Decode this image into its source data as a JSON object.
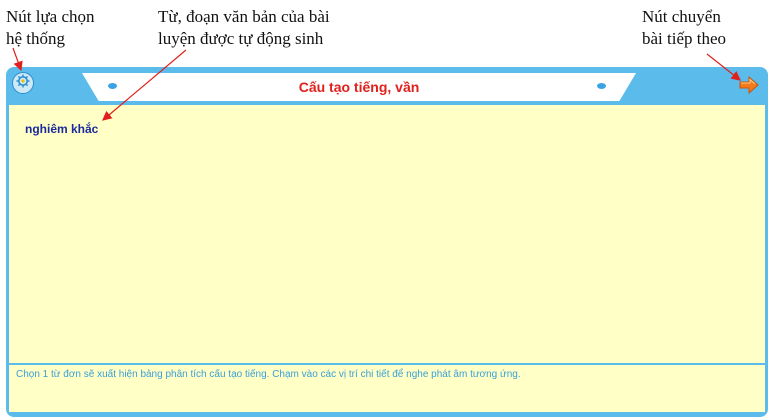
{
  "annotations": {
    "system_line1": "Nút lựa chọn",
    "system_line2": "hệ thống",
    "text_line1": "Từ, đoạn văn bản của bài",
    "text_line2": "luyện được tự động sinh",
    "next_line1": "Nút chuyển",
    "next_line2": "bài tiếp theo"
  },
  "app": {
    "title": "Cấu tạo tiếng, vần",
    "word": "nghiêm khắc",
    "instruction": "Chọn 1 từ đơn sẽ xuất hiện bảng phân tích cấu tạo tiếng. Chạm vào các vị trí chi tiết để nghe phát âm tương ứng."
  },
  "icons": {
    "system": "gear-icon",
    "next": "arrow-right-icon"
  },
  "colors": {
    "frame": "#5bbcec",
    "content_bg": "#ffffc6",
    "title_text": "#e0201c",
    "word_text": "#1a2a9c",
    "instruction_text": "#3a9fd8",
    "annotation_arrow": "#e0201c"
  }
}
